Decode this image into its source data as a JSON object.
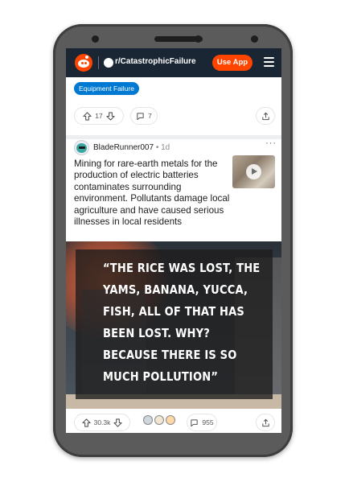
{
  "topbar": {
    "subreddit": "r/CatastrophicFailure",
    "use_app_label": "Use App",
    "icons": [
      "reddit-logo",
      "subreddit-icon",
      "hamburger-menu-icon"
    ]
  },
  "prev_post": {
    "flair": "Equipment Failure",
    "votes": "17",
    "comments": "7"
  },
  "post": {
    "author": "BladeRunner007",
    "age": "1d",
    "title": "Mining for rare-earth metals for the production of electric batteries contaminates surrounding environment. Pollutants damage local agriculture and have caused serious illnesses in local residents",
    "video_quote": "“The rice was lost, the yams, banana, yucca, fish, all of that has been lost. Why? Because there is so much pollution”",
    "votes": "30.3k",
    "comments": "955"
  },
  "colors": {
    "brand": "#ff4500",
    "topbar_bg": "#1a2634",
    "flair_bg": "#0079d3"
  }
}
